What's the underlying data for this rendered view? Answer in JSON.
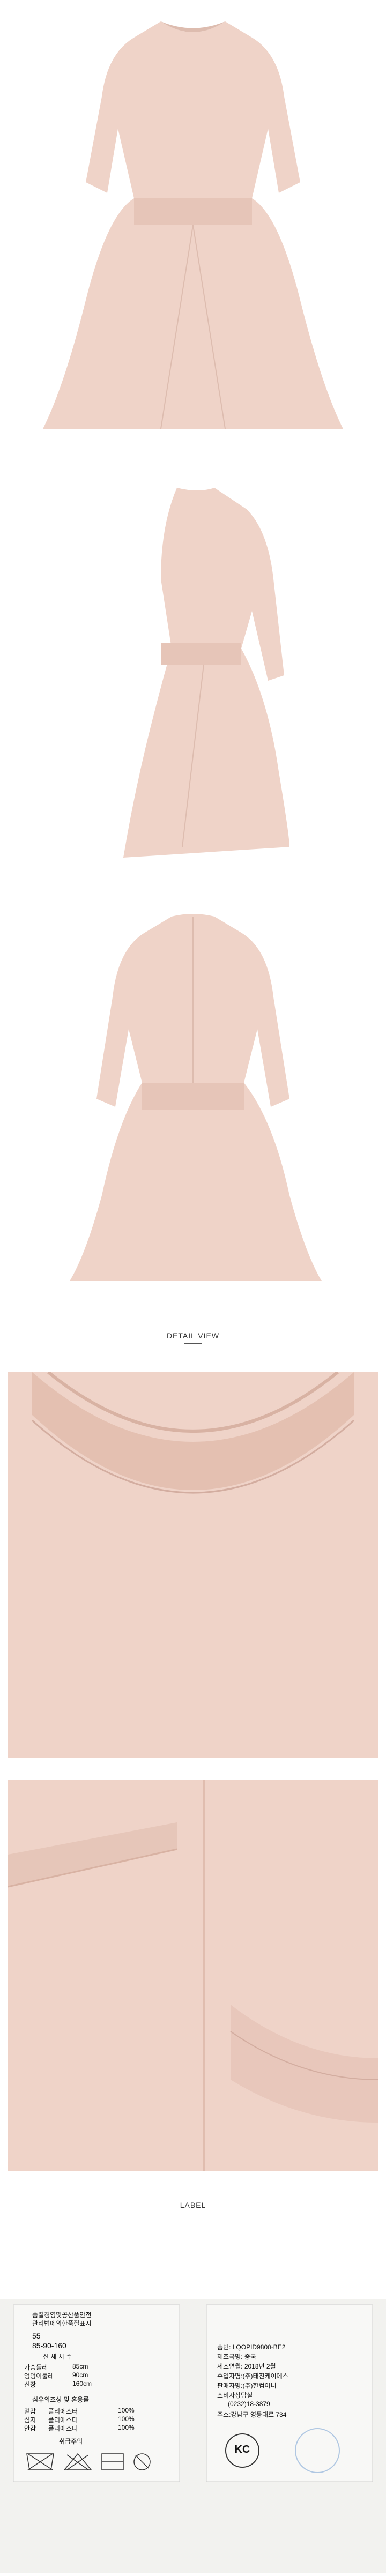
{
  "sections": {
    "detail_title": "DETAIL VIEW",
    "label_title": "LABEL"
  },
  "colors": {
    "fabric": "#efd3c8",
    "fabric_shadow": "#ddbcaf",
    "background": "#ffffff"
  },
  "images": [
    {
      "alt": "Front view of pink dress"
    },
    {
      "alt": "Side view of pink dress"
    },
    {
      "alt": "Back view of pink dress"
    },
    {
      "alt": "Detail of neckline"
    },
    {
      "alt": "Detail of sleeve cuff"
    }
  ],
  "label_left": {
    "header1": "품질경영및공산품안전",
    "header2": "관리법에의한품질표시",
    "size": "55",
    "measure": "85-90-160",
    "measure_caption": "신 체 치 수",
    "rows": [
      {
        "k": "가슴둘레",
        "v": "85cm"
      },
      {
        "k": "엉덩이둘레",
        "v": "90cm"
      },
      {
        "k": "신장",
        "v": "160cm"
      }
    ],
    "composition_title": "섬유의조성 및 혼용률",
    "composition": [
      {
        "k": "겉감",
        "m": "폴리에스터",
        "p": "100%"
      },
      {
        "k": "심지",
        "m": "폴리에스터",
        "p": "100%"
      },
      {
        "k": "안감",
        "m": "폴리에스터",
        "p": "100%"
      }
    ],
    "care": "취급주의"
  },
  "label_right": {
    "line1": "KC",
    "item_no": "품번: LQOPID9800-BE2",
    "origin": "제조국명: 중국",
    "date": "제조연월: 2018년 2월",
    "importer": "수입자명:(주)태진케이에스",
    "seller": "판매자명:(주)한컴어니",
    "cs": "소비자상담실",
    "phone": "(0232)18-3879",
    "address": "주소:강남구 영동대로 734"
  }
}
